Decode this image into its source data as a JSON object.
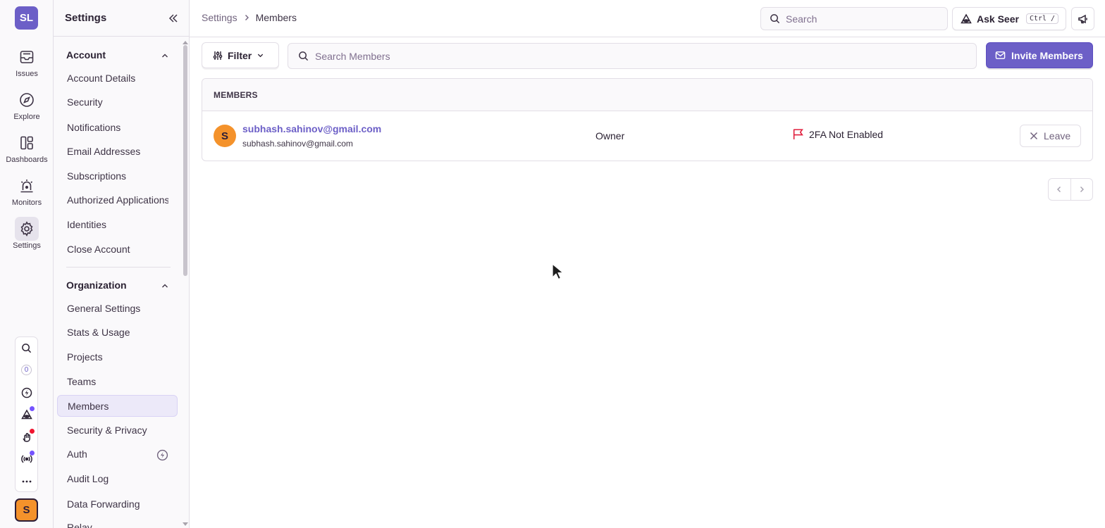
{
  "rail": {
    "org_initials": "SL",
    "items": [
      {
        "label": "Issues",
        "icon": "inbox-icon"
      },
      {
        "label": "Explore",
        "icon": "compass-icon"
      },
      {
        "label": "Dashboards",
        "icon": "dashboard-icon"
      },
      {
        "label": "Monitors",
        "icon": "siren-icon"
      },
      {
        "label": "Settings",
        "icon": "gear-icon",
        "active": true
      }
    ],
    "tools": {
      "search_icon": "search-icon",
      "onboarding_count": "0",
      "icons": [
        "lightning-icon",
        "seer-icon",
        "whats-new-icon",
        "broadcast-icon",
        "more-icon"
      ],
      "dot_colors": {
        "seer": "#7553ff",
        "whats_new": "#f0142f",
        "broadcast": "#7553ff"
      }
    },
    "user_initial": "S"
  },
  "secnav": {
    "title": "Settings",
    "account_section": "Account",
    "account_items": [
      "Account Details",
      "Security",
      "Notifications",
      "Email Addresses",
      "Subscriptions",
      "Authorized Applications",
      "Identities",
      "Close Account"
    ],
    "org_section": "Organization",
    "org_items": [
      "General Settings",
      "Stats & Usage",
      "Projects",
      "Teams",
      "Members",
      "Security & Privacy",
      "Auth",
      "Audit Log",
      "Data Forwarding",
      "Relay"
    ],
    "active_item": "Members"
  },
  "header": {
    "breadcrumb_root": "Settings",
    "breadcrumb_current": "Members",
    "search_placeholder": "Search",
    "ask_seer_label": "Ask Seer",
    "ask_seer_shortcut": "Ctrl /"
  },
  "main": {
    "filter_label": "Filter",
    "search_placeholder": "Search Members",
    "invite_label": "Invite Members",
    "table_header": "MEMBERS",
    "members": [
      {
        "initial": "S",
        "name": "subhash.sahinov@gmail.com",
        "email": "subhash.sahinov@gmail.com",
        "role": "Owner",
        "twofa_status": "2FA Not Enabled",
        "action_label": "Leave"
      }
    ]
  },
  "colors": {
    "accent": "#6c5fc7",
    "warning_flag": "#e01f3d",
    "avatar": "#f4922b"
  }
}
